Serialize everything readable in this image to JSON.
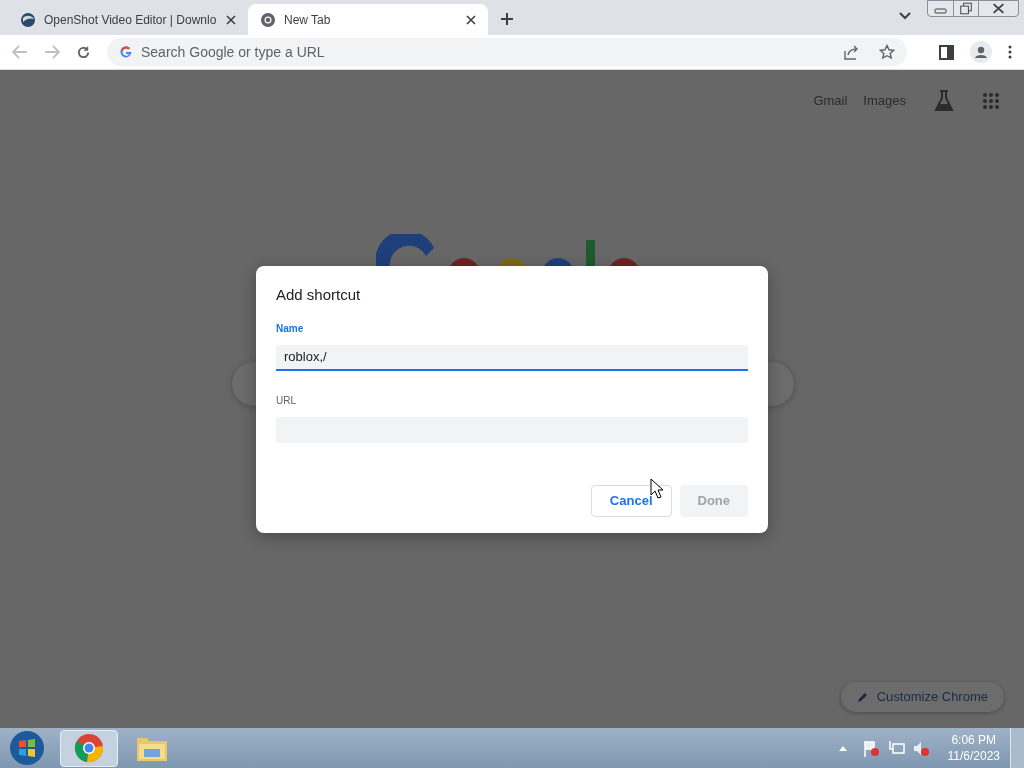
{
  "tabs": [
    {
      "title": "OpenShot Video Editor | Downlo",
      "selected": false
    },
    {
      "title": "New Tab",
      "selected": true
    }
  ],
  "address_bar": {
    "placeholder": "Search Google or type a URL"
  },
  "header_links": [
    "Gmail",
    "Images"
  ],
  "dialog": {
    "title": "Add shortcut",
    "fields": [
      {
        "label": "Name",
        "value": "roblox,/",
        "focused": true
      },
      {
        "label": "URL",
        "focused": false
      }
    ],
    "buttons": [
      {
        "label": "Cancel",
        "disabled": false
      },
      {
        "label": "Done",
        "disabled": true
      }
    ]
  },
  "customize_button": "Customize Chrome",
  "taskbar": {
    "time": "6:06 PM",
    "date": "11/6/2023"
  }
}
